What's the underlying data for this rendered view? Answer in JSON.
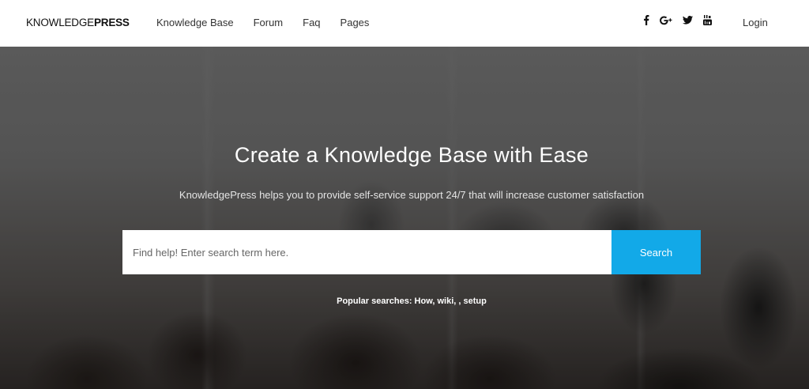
{
  "header": {
    "logo_light": "KNOWLEDGE",
    "logo_bold": "PRESS",
    "nav": [
      {
        "label": "Knowledge Base"
      },
      {
        "label": "Forum"
      },
      {
        "label": "Faq"
      },
      {
        "label": "Pages"
      }
    ],
    "social": [
      {
        "icon": "facebook-icon",
        "glyph": "f"
      },
      {
        "icon": "google-plus-icon",
        "glyph": "G+"
      },
      {
        "icon": "twitter-icon",
        "glyph": "twitter"
      },
      {
        "icon": "youtube-icon",
        "glyph": "youtube"
      }
    ],
    "login_label": "Login"
  },
  "hero": {
    "title": "Create a Knowledge Base with Ease",
    "subtitle": "KnowledgePress helps you to provide self-service support 24/7 that will increase customer satisfaction",
    "search": {
      "placeholder": "Find help! Enter search term here.",
      "value": "",
      "button_label": "Search"
    },
    "popular": {
      "label": "Popular searches:",
      "terms": [
        "How",
        "wiki",
        "",
        "setup"
      ]
    }
  },
  "colors": {
    "accent": "#12a9e8",
    "header_bg": "#ffffff",
    "hero_text": "#ffffff"
  }
}
